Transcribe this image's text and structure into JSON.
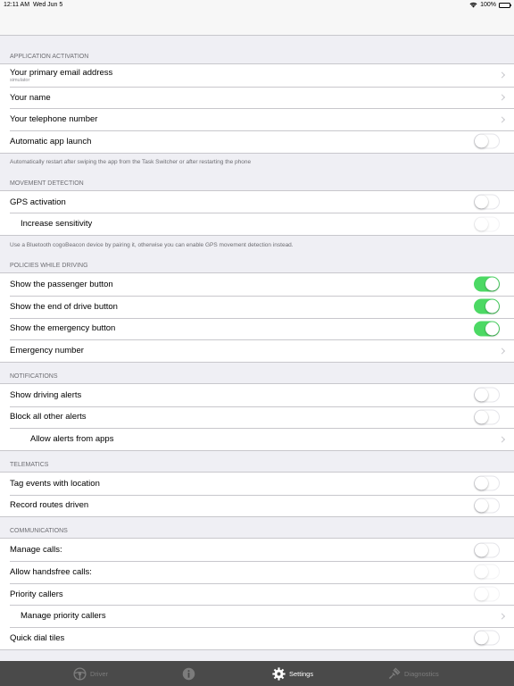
{
  "status": {
    "time": "12:11 AM",
    "date": "Wed Jun 5",
    "battery": "100%"
  },
  "sections": [
    {
      "header": "APPLICATION ACTIVATION",
      "rows": [
        {
          "label": "Your primary email address",
          "sub": "simulator",
          "accessory": "chevron"
        },
        {
          "label": "Your name",
          "accessory": "chevron"
        },
        {
          "label": "Your telephone number",
          "accessory": "chevron"
        },
        {
          "label": "Automatic app launch",
          "accessory": "toggle",
          "on": false
        }
      ],
      "footer": "Automatically restart after swiping the app from the Task Switcher or after restarting the phone"
    },
    {
      "header": "MOVEMENT DETECTION",
      "rows": [
        {
          "label": "GPS activation",
          "accessory": "toggle",
          "on": false
        },
        {
          "label": "Increase sensitivity",
          "accessory": "toggle",
          "on": false,
          "disabled": true,
          "indent": 1
        }
      ],
      "footer": "Use a Bluetooth cogoBeacon device by pairing it, otherwise you can enable GPS movement detection instead."
    },
    {
      "header": "POLICIES WHILE DRIVING",
      "rows": [
        {
          "label": "Show the passenger button",
          "accessory": "toggle",
          "on": true
        },
        {
          "label": "Show the end of drive button",
          "accessory": "toggle",
          "on": true
        },
        {
          "label": "Show the emergency button",
          "accessory": "toggle",
          "on": true
        },
        {
          "label": "Emergency number",
          "accessory": "chevron"
        }
      ],
      "footer": ""
    },
    {
      "header": "NOTIFICATIONS",
      "rows": [
        {
          "label": "Show driving alerts",
          "accessory": "toggle",
          "on": false
        },
        {
          "label": "Block all other alerts",
          "accessory": "toggle",
          "on": false
        },
        {
          "label": "Allow alerts from apps",
          "accessory": "chevron",
          "indent": 2
        }
      ],
      "footer": ""
    },
    {
      "header": "TELEMATICS",
      "rows": [
        {
          "label": "Tag events with location",
          "accessory": "toggle",
          "on": false
        },
        {
          "label": "Record routes driven",
          "accessory": "toggle",
          "on": false
        }
      ],
      "footer": ""
    },
    {
      "header": "COMMUNICATIONS",
      "rows": [
        {
          "label": "Manage calls:",
          "accessory": "toggle",
          "on": false
        },
        {
          "label": "Allow handsfree calls:",
          "accessory": "toggle",
          "on": false,
          "disabled": true
        },
        {
          "label": "Priority callers",
          "accessory": "toggle",
          "on": false,
          "disabled": true
        },
        {
          "label": "Manage priority callers",
          "accessory": "chevron",
          "indent": 1
        },
        {
          "label": "Quick dial tiles",
          "accessory": "toggle",
          "on": false
        }
      ],
      "footer": ""
    }
  ],
  "tabs": [
    {
      "label": "Driver",
      "icon": "steering-wheel-icon"
    },
    {
      "label": "",
      "icon": "info-icon"
    },
    {
      "label": "Settings",
      "icon": "gear-icon",
      "active": true
    },
    {
      "label": "Diagnostics",
      "icon": "diagnostics-icon"
    }
  ],
  "colors": {
    "toggle_on": "#4cd964",
    "tab_bar": "#4a4a4a",
    "background": "#efeff4"
  }
}
